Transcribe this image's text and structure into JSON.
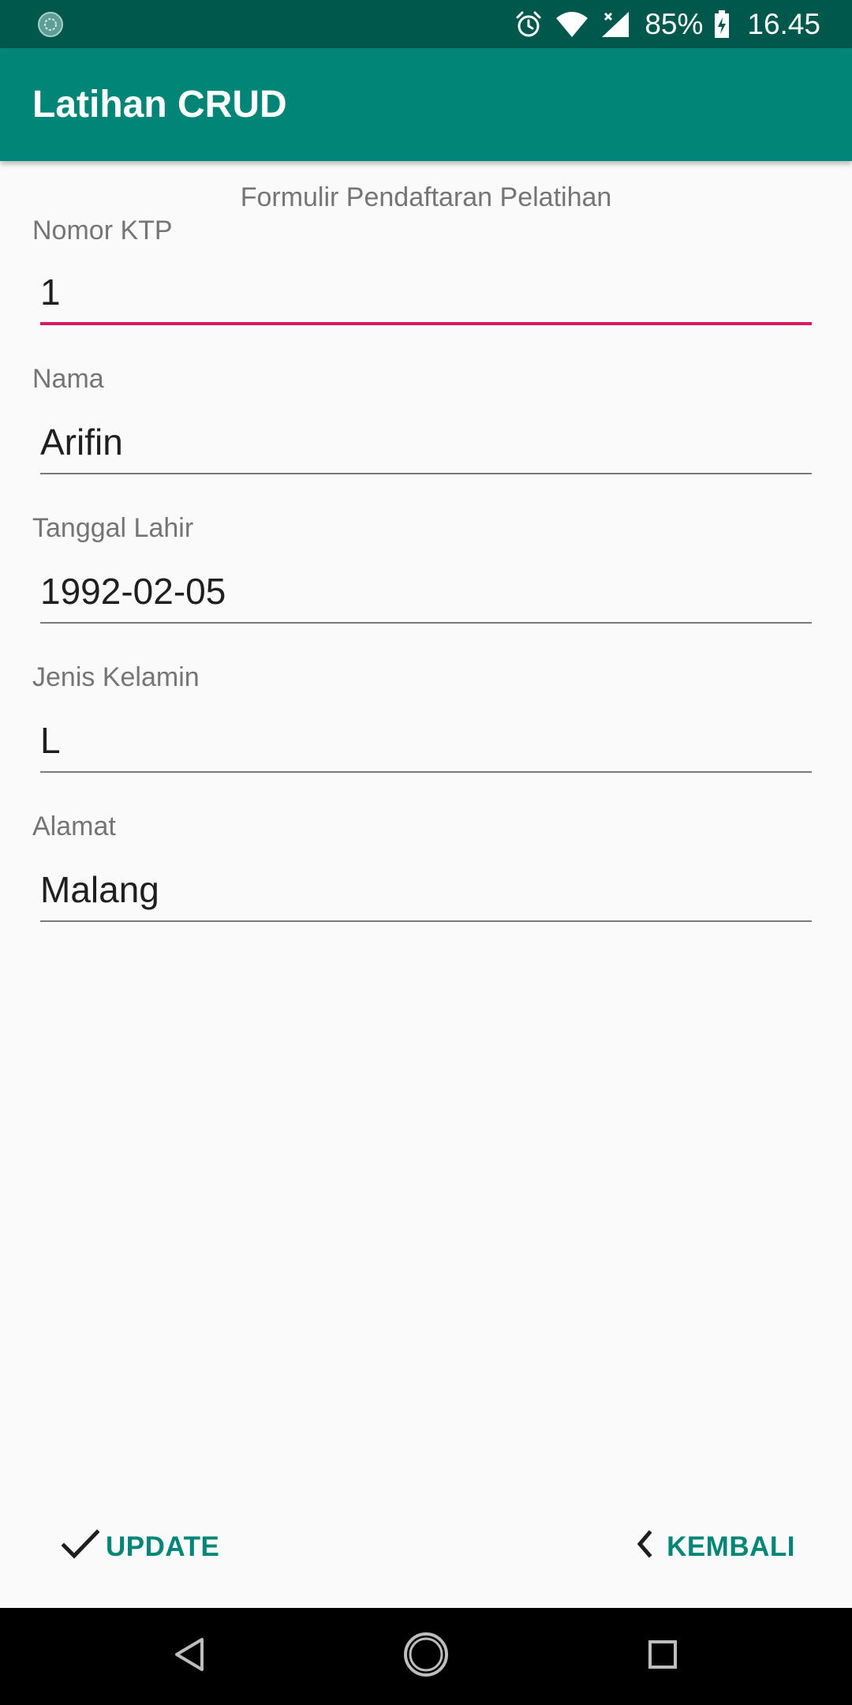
{
  "status_bar": {
    "battery_percent": "85%",
    "time": "16.45"
  },
  "app_bar": {
    "title": "Latihan CRUD"
  },
  "form": {
    "heading": "Formulir Pendaftaran Pelatihan",
    "fields": [
      {
        "label": "Nomor KTP",
        "value": "1",
        "focused": true
      },
      {
        "label": "Nama",
        "value": "Arifin"
      },
      {
        "label": "Tanggal Lahir",
        "value": "1992-02-05"
      },
      {
        "label": "Jenis Kelamin",
        "value": "L"
      },
      {
        "label": "Alamat",
        "value": "Malang"
      }
    ]
  },
  "actions": {
    "update_label": "UPDATE",
    "kembali_label": "KEMBALI"
  },
  "colors": {
    "status_bar": "#00574b",
    "app_bar": "#008577",
    "accent": "#d81b60",
    "button_text": "#008577"
  },
  "icons": {
    "status_left": "sync-circle-icon",
    "alarm": "alarm-icon",
    "wifi": "wifi-icon",
    "signal": "cell-signal-icon",
    "battery": "battery-charging-icon",
    "update": "check-icon",
    "kembali": "chevron-left-icon",
    "nav_back": "nav-back-icon",
    "nav_home": "nav-home-icon",
    "nav_recents": "nav-recents-icon"
  }
}
